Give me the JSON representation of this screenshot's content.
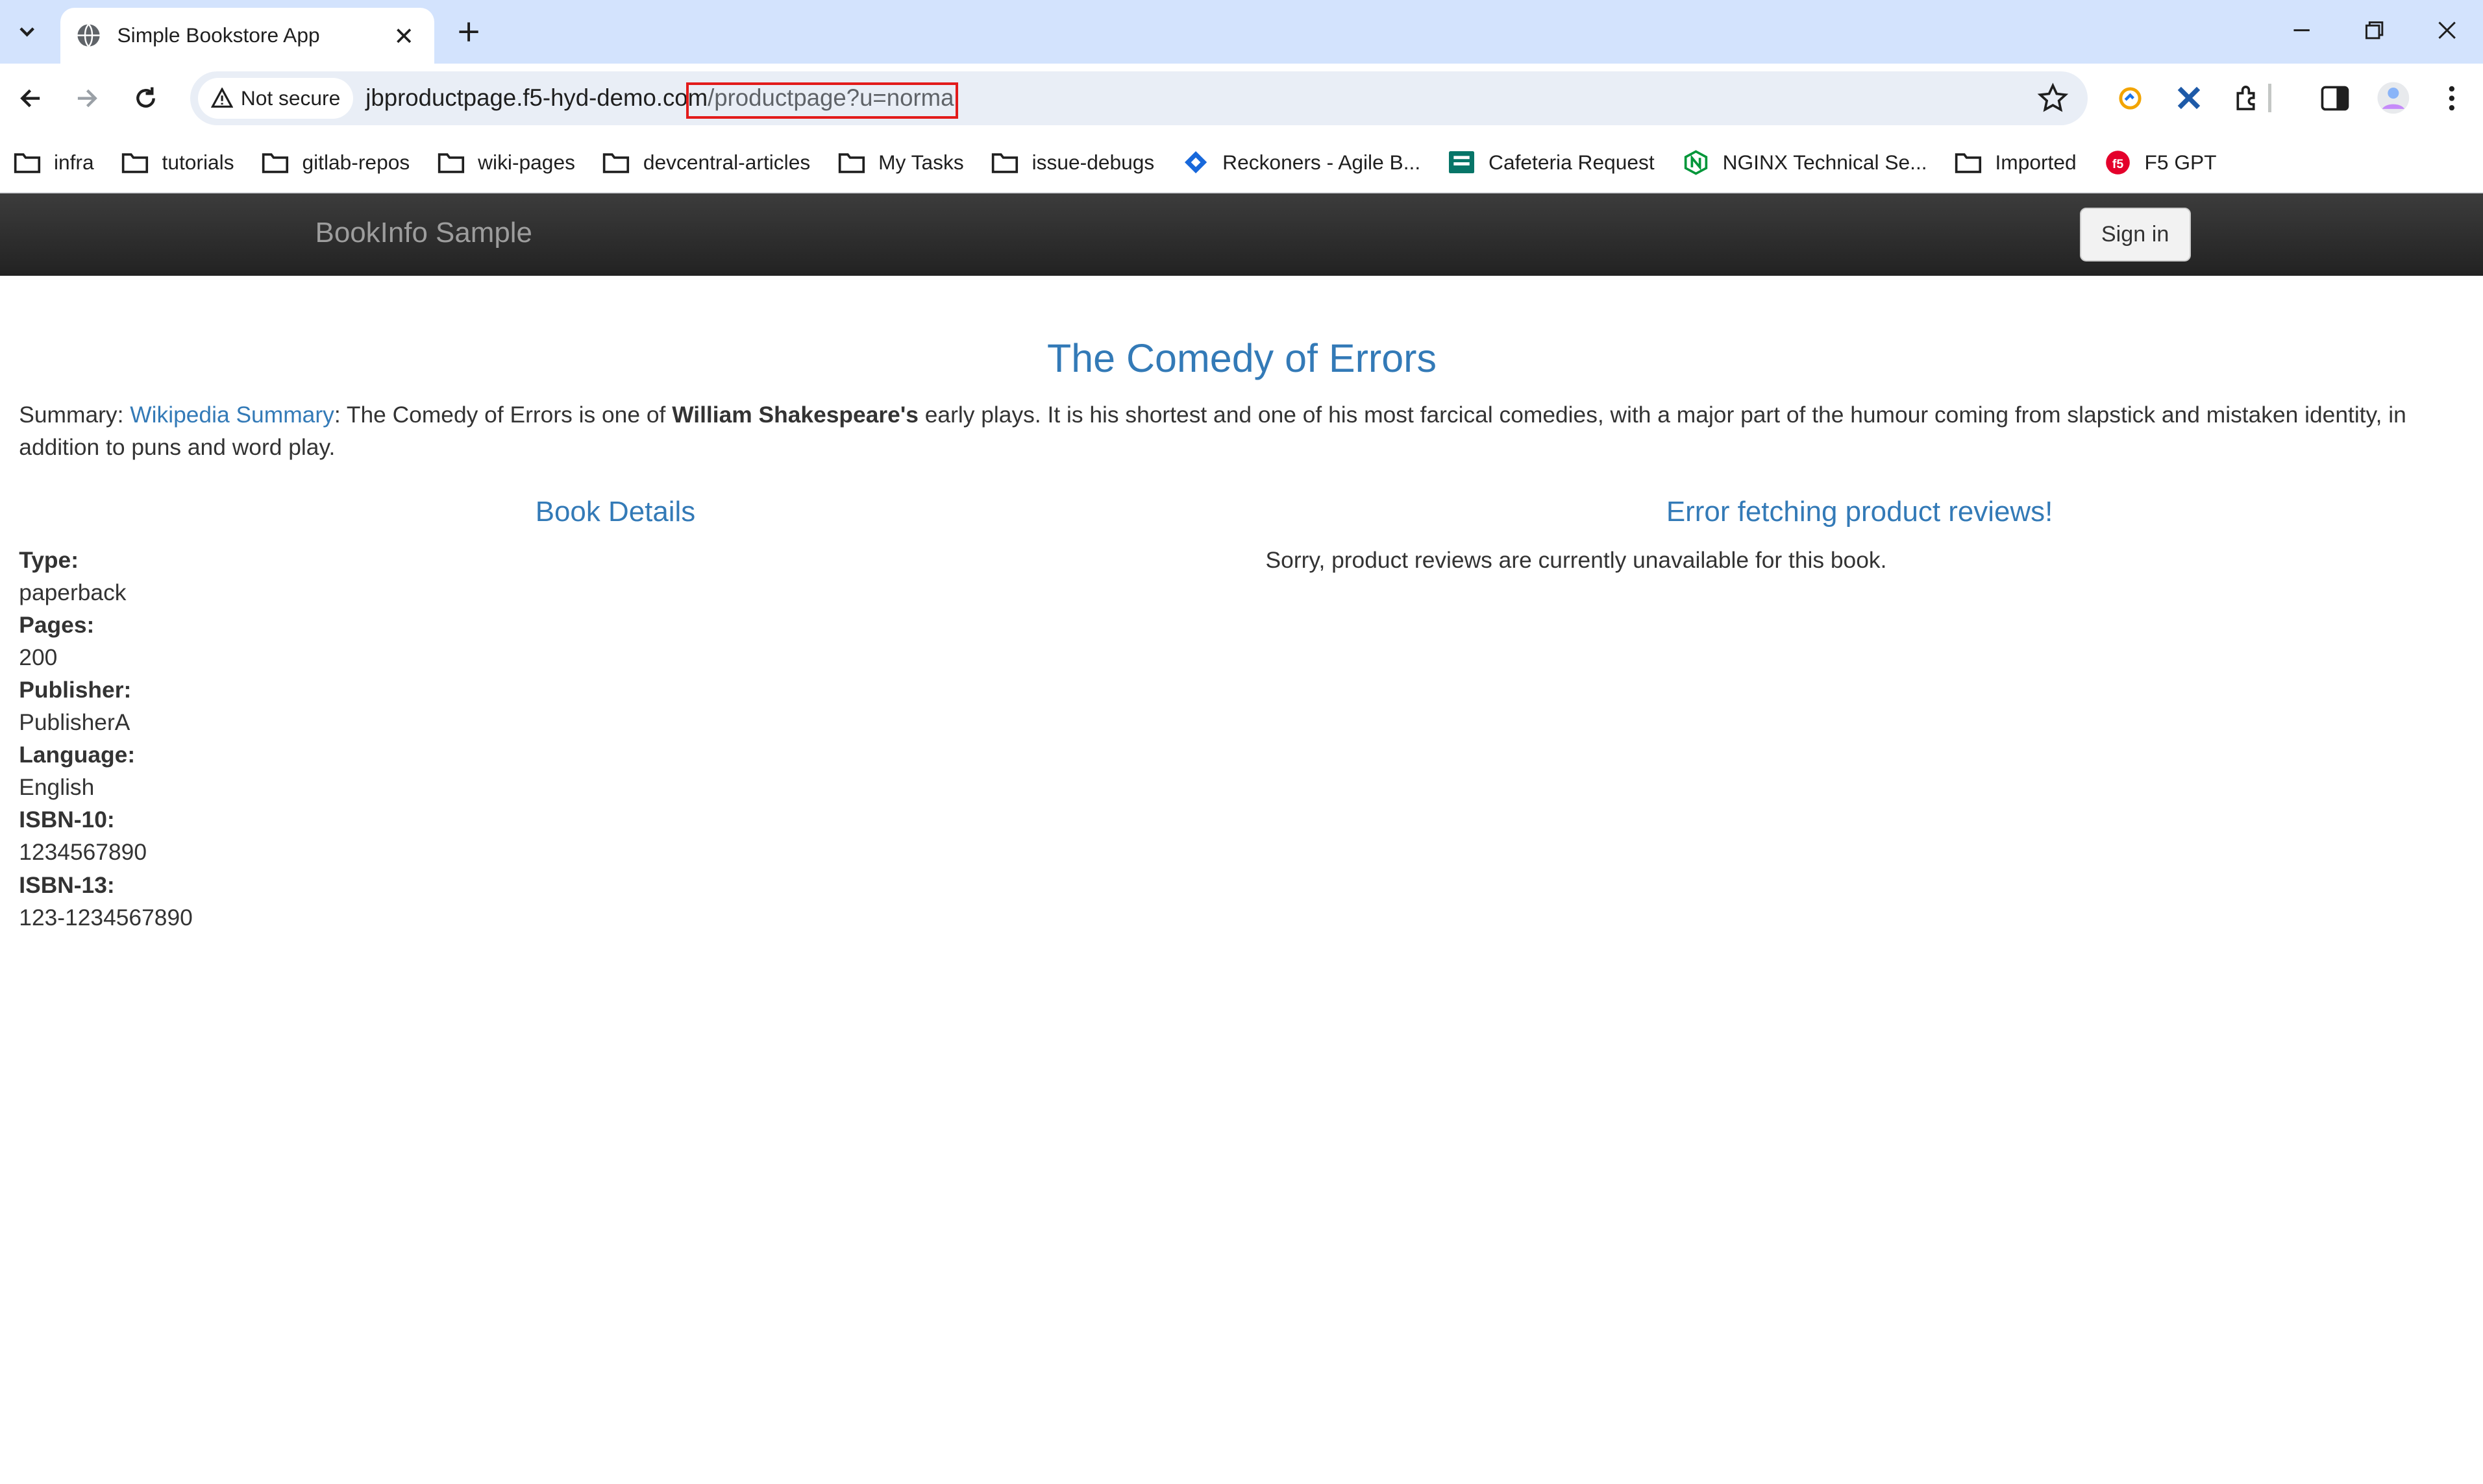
{
  "browser": {
    "tab_title": "Simple Bookstore App",
    "security_chip": "Not secure",
    "url_host": "jbproductpage.f5-hyd-demo.com",
    "url_path": "/productpage?u=normal"
  },
  "bookmarks": [
    {
      "label": "infra",
      "icon": "folder-icon"
    },
    {
      "label": "tutorials",
      "icon": "folder-icon"
    },
    {
      "label": "gitlab-repos",
      "icon": "folder-icon"
    },
    {
      "label": "wiki-pages",
      "icon": "folder-icon"
    },
    {
      "label": "devcentral-articles",
      "icon": "folder-icon"
    },
    {
      "label": "My Tasks",
      "icon": "folder-icon"
    },
    {
      "label": "issue-debugs",
      "icon": "folder-icon"
    },
    {
      "label": "Reckoners - Agile B...",
      "icon": "jira-icon"
    },
    {
      "label": "Cafeteria Request",
      "icon": "forms-icon"
    },
    {
      "label": "NGINX Technical Se...",
      "icon": "nginx-icon"
    },
    {
      "label": "Imported",
      "icon": "folder-icon"
    },
    {
      "label": "F5 GPT",
      "icon": "f5-icon"
    }
  ],
  "page": {
    "brand": "BookInfo Sample",
    "sign_in": "Sign in",
    "title": "The Comedy of Errors",
    "summary_prefix": "Summary: ",
    "summary_link": "Wikipedia Summary",
    "summary_mid": ": The Comedy of Errors is one of ",
    "summary_bold": "William Shakespeare's",
    "summary_rest": " early plays. It is his shortest and one of his most farcical comedies, with a major part of the humour coming from slapstick and mistaken identity, in addition to puns and word play.",
    "details_heading": "Book Details",
    "details": [
      {
        "label": "Type:",
        "value": "paperback"
      },
      {
        "label": "Pages:",
        "value": "200"
      },
      {
        "label": "Publisher:",
        "value": "PublisherA"
      },
      {
        "label": "Language:",
        "value": "English"
      },
      {
        "label": "ISBN-10:",
        "value": "1234567890"
      },
      {
        "label": "ISBN-13:",
        "value": "123-1234567890"
      }
    ],
    "reviews_heading": "Error fetching product reviews!",
    "reviews_message": "Sorry, product reviews are currently unavailable for this book."
  },
  "colors": {
    "link": "#337ab7",
    "navbar": "#222222",
    "highlight": "#e21b1b",
    "tabstrip": "#d3e3fd"
  }
}
